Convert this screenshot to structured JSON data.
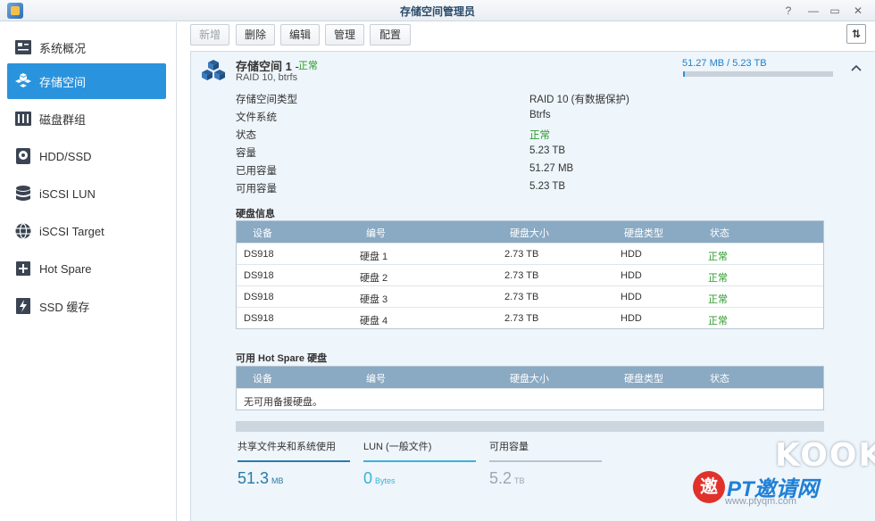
{
  "window": {
    "title": "存储空间管理员",
    "controls": [
      "?",
      "—",
      "▭",
      "✕"
    ]
  },
  "sidebar": {
    "items": [
      {
        "label": "系统概况",
        "icon": "overview-icon",
        "active": false
      },
      {
        "label": "存储空间",
        "icon": "volume-icon",
        "active": true
      },
      {
        "label": "磁盘群组",
        "icon": "disk-group-icon",
        "active": false
      },
      {
        "label": "HDD/SSD",
        "icon": "hdd-icon",
        "active": false
      },
      {
        "label": "iSCSI LUN",
        "icon": "database-icon",
        "active": false
      },
      {
        "label": "iSCSI Target",
        "icon": "globe-icon",
        "active": false
      },
      {
        "label": "Hot Spare",
        "icon": "plus-icon",
        "active": false
      },
      {
        "label": "SSD 缓存",
        "icon": "lightning-icon",
        "active": false
      }
    ]
  },
  "toolbar": {
    "new_label": "新增",
    "delete_label": "删除",
    "edit_label": "编辑",
    "manage_label": "管理",
    "config_label": "配置"
  },
  "volume": {
    "title": "存储空间 1",
    "separator": "-",
    "status": "正常",
    "subtitle": "RAID 10, btrfs",
    "usage_text": "51.27 MB / 5.23 TB",
    "usage_fraction": 0.01,
    "accent_color": "#2a93dd",
    "ok_color": "#2b9a2b"
  },
  "properties": [
    {
      "label": "存储空间类型",
      "value": "RAID 10 (有数据保护)",
      "ok": false
    },
    {
      "label": "文件系统",
      "value": "Btrfs",
      "ok": false
    },
    {
      "label": "状态",
      "value": "正常",
      "ok": true
    },
    {
      "label": "容量",
      "value": "5.23 TB",
      "ok": false
    },
    {
      "label": "已用容量",
      "value": "51.27 MB",
      "ok": false
    },
    {
      "label": "可用容量",
      "value": "5.23 TB",
      "ok": false
    }
  ],
  "disk_info": {
    "title": "硬盘信息",
    "columns": [
      "设备",
      "编号",
      "硬盘大小",
      "硬盘类型",
      "状态"
    ],
    "rows": [
      [
        "DS918",
        "硬盘 1",
        "2.73 TB",
        "HDD",
        "正常"
      ],
      [
        "DS918",
        "硬盘 2",
        "2.73 TB",
        "HDD",
        "正常"
      ],
      [
        "DS918",
        "硬盘 3",
        "2.73 TB",
        "HDD",
        "正常"
      ],
      [
        "DS918",
        "硬盘 4",
        "2.73 TB",
        "HDD",
        "正常"
      ]
    ]
  },
  "hot_spare": {
    "title": "可用 Hot Spare 硬盘",
    "columns": [
      "设备",
      "编号",
      "硬盘大小",
      "硬盘类型",
      "状态"
    ],
    "empty_text": "无可用备援硬盘。"
  },
  "stats": [
    {
      "label": "共享文件夹和系统使用",
      "value": "51.3",
      "unit": "MB",
      "line_color": "#2a7aa8",
      "value_color": "#2a7aa8"
    },
    {
      "label": "LUN (一般文件)",
      "value": "0",
      "unit": "Bytes",
      "line_color": "#38b3d6",
      "value_color": "#38b3d6"
    },
    {
      "label": "可用容量",
      "value": "5.2",
      "unit": "TB",
      "line_color": "#b9c4cd",
      "value_color": "#9aa7b2"
    }
  ],
  "watermark": {
    "brand": "KOOK",
    "badge": "邀",
    "text": "PT邀请网",
    "url": "www.ptyqm.com"
  }
}
